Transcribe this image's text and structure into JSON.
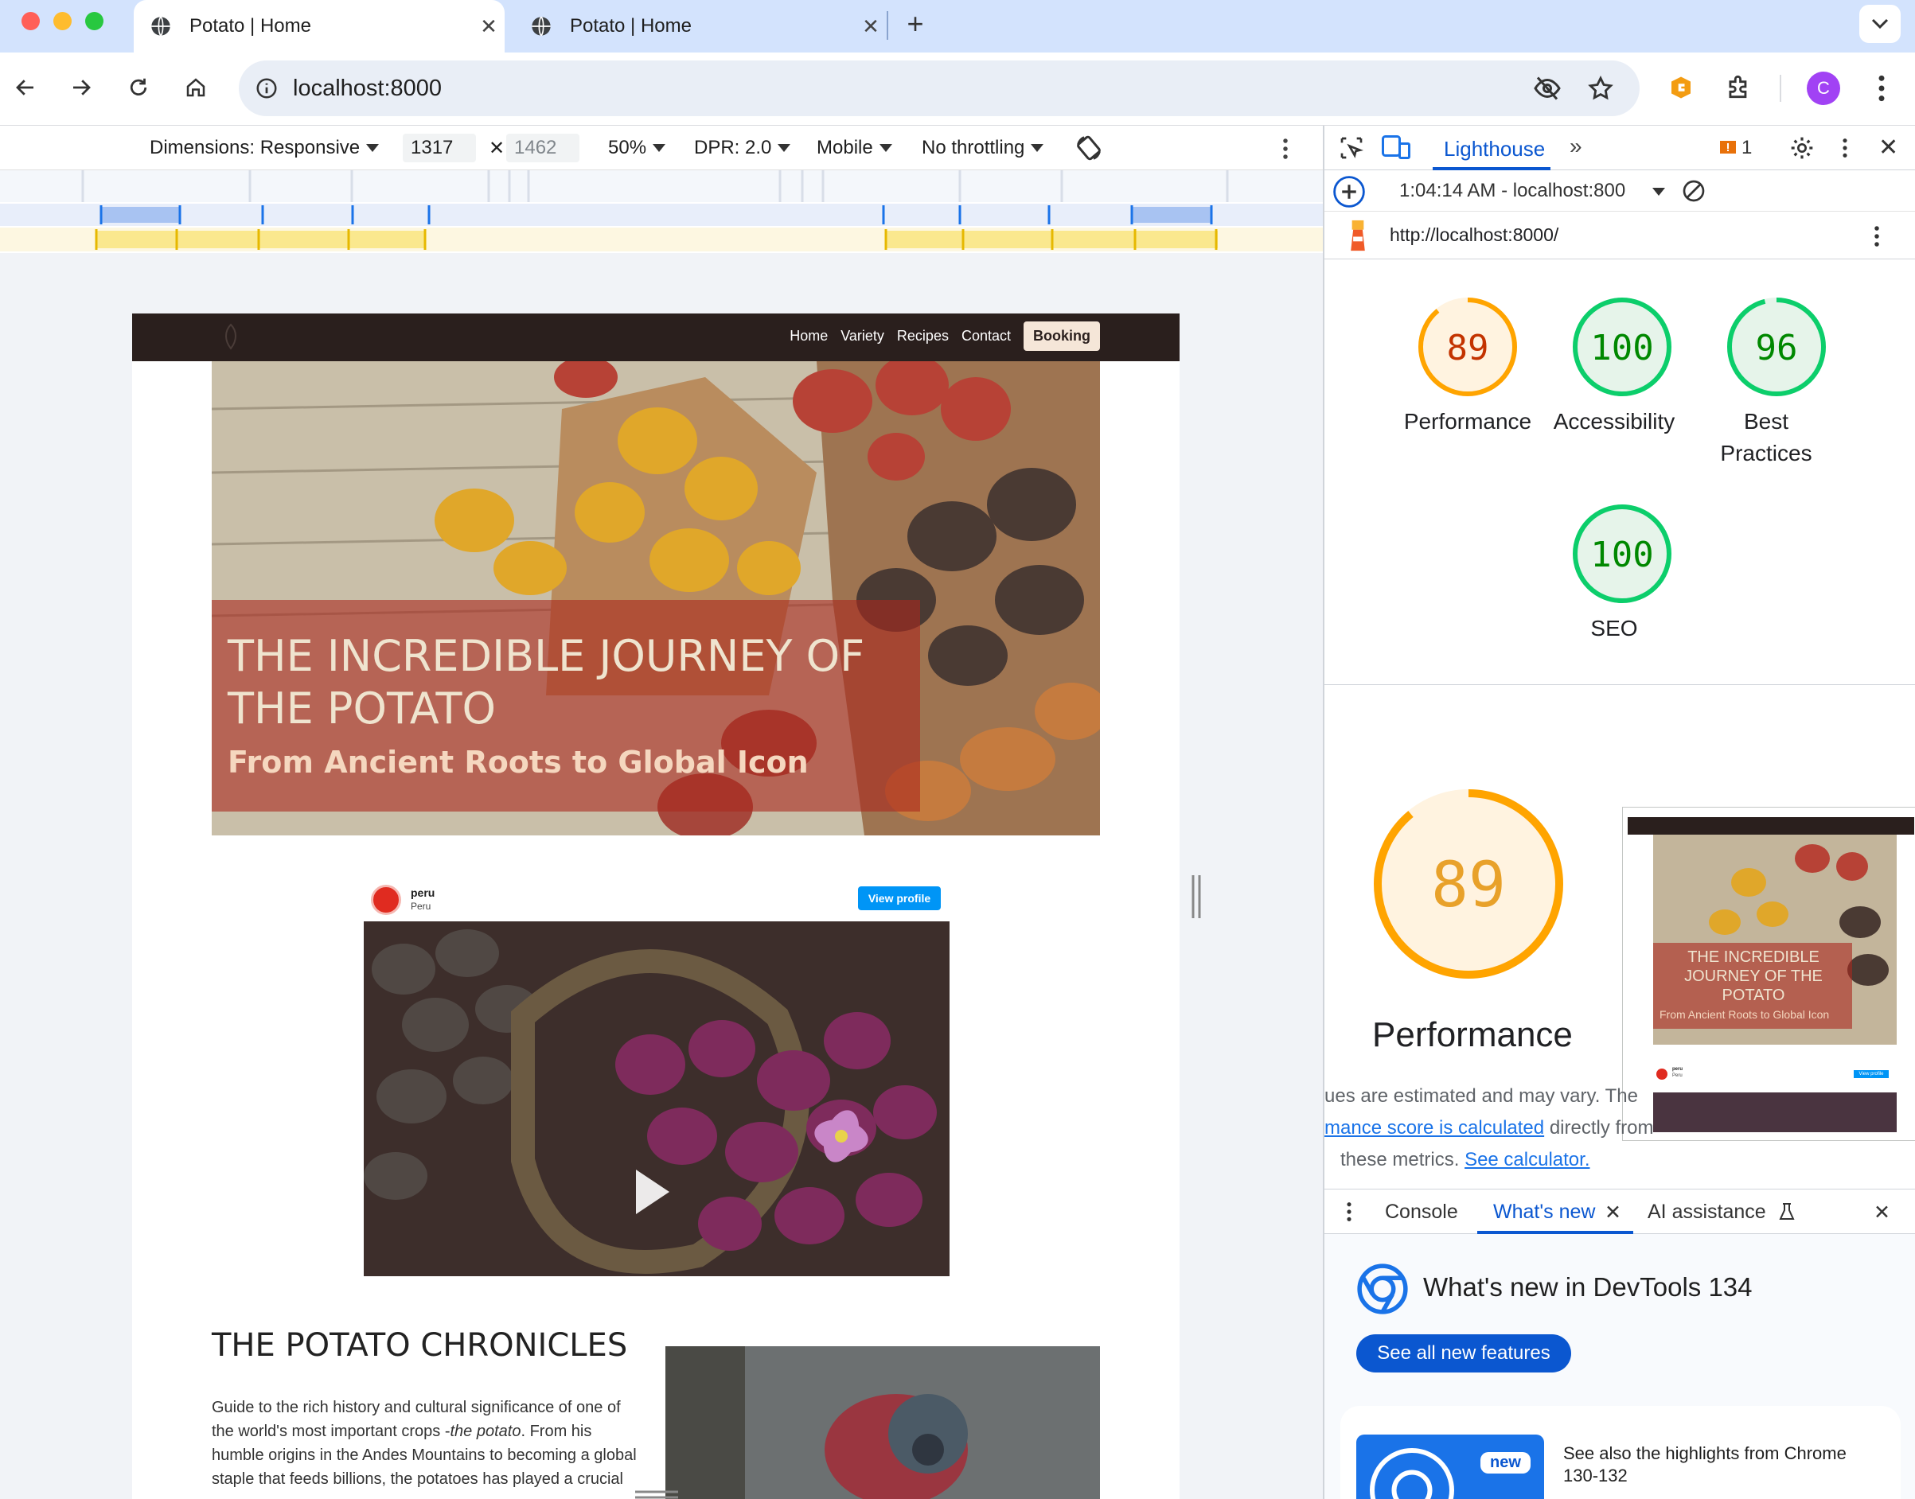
{
  "browser": {
    "tabs": [
      {
        "title": "Potato | Home",
        "active": true
      },
      {
        "title": "Potato | Home",
        "active": false
      }
    ],
    "url": "localhost:8000",
    "profile_initial": "C"
  },
  "device_toolbar": {
    "dimensions_label": "Dimensions: Responsive",
    "width": "1317",
    "height": "1462",
    "zoom": "50%",
    "dpr": "DPR: 2.0",
    "device_type": "Mobile",
    "throttling": "No throttling"
  },
  "site": {
    "nav": [
      "Home",
      "Variety",
      "Recipes",
      "Contact"
    ],
    "booking": "Booking",
    "hero_title": "THE INCREDIBLE JOURNEY OF THE POTATO",
    "hero_subtitle": "From Ancient Roots to Global Icon",
    "embed": {
      "name": "peru",
      "sub": "Peru",
      "button": "View profile"
    },
    "chronicles_title": "THE POTATO CHRONICLES",
    "chronicles_text_a": "Guide to the rich history and cultural significance of one of the world's most important crops -",
    "chronicles_text_em": "the potato",
    "chronicles_text_b": ". From his humble origins in the Andes Mountains to becoming a global staple that feeds billions, the potatoes has played a crucial"
  },
  "devtools": {
    "active_panel": "Lighthouse",
    "issues_count": "1",
    "report_time": "1:04:14 AM - localhost:800",
    "report_url": "http://localhost:8000/",
    "scores": [
      {
        "value": 89,
        "label": "Performance",
        "color": "#ffa400",
        "fill": "#fff3e0",
        "text": "#c33300"
      },
      {
        "value": 100,
        "label": "Accessibility",
        "color": "#0cce6b",
        "fill": "#e6f4ea",
        "text": "#008800"
      },
      {
        "value": 96,
        "label": "Best Practices",
        "color": "#0cce6b",
        "fill": "#e6f4ea",
        "text": "#008800"
      },
      {
        "value": 100,
        "label": "SEO",
        "color": "#0cce6b",
        "fill": "#e6f4ea",
        "text": "#008800"
      }
    ],
    "perf_big_value": "89",
    "perf_big_label": "Performance",
    "perf_note_1": "ues are estimated and may vary. The",
    "perf_note_link": "mance score is calculated",
    "perf_note_2": "directly from",
    "perf_note_3": "these metrics.",
    "perf_note_link2": "See calculator.",
    "thumb_title": "THE INCREDIBLE JOURNEY OF THE POTATO",
    "thumb_sub": "From Ancient Roots to Global Icon",
    "thumb_name": "peru",
    "thumb_place": "Peru",
    "thumb_button": "View profile",
    "drawer_tabs": [
      "Console",
      "What's new",
      "AI assistance"
    ],
    "whats_new_title": "What's new in DevTools 134",
    "whats_new_button": "See all new features",
    "whats_new_badge": "new",
    "whats_new_card_text": "See also the highlights from Chrome 130-132"
  }
}
